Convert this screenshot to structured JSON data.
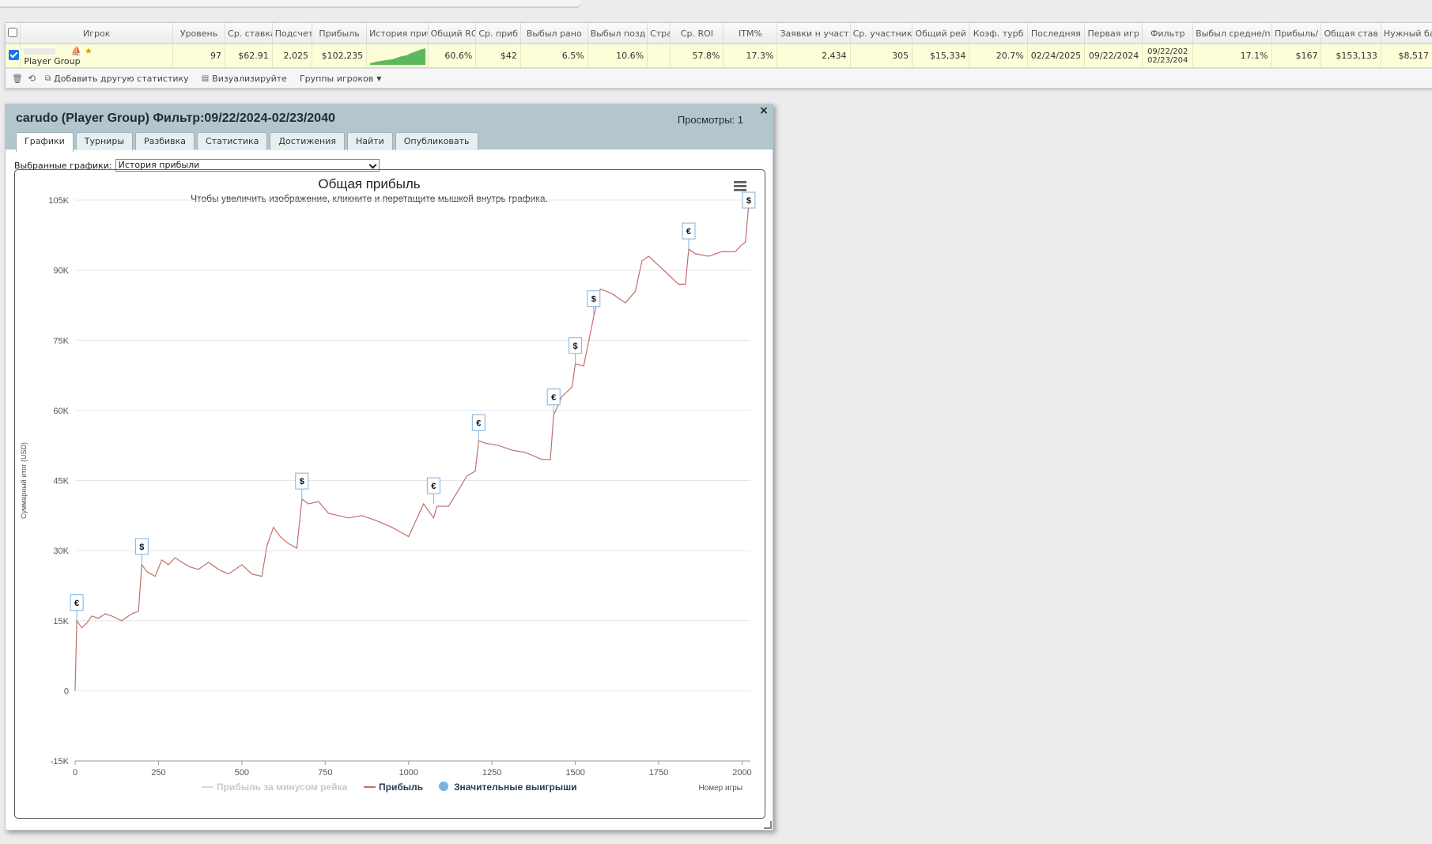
{
  "grid": {
    "columns": [
      "",
      "Игрок",
      "Уровень",
      "Ср. ставка",
      "Подсчет",
      "Прибыль",
      "История прибы",
      "Общий ROI",
      "Ср. приб",
      "Выбыл рано",
      "Выбыл позд",
      "Стра",
      "Ср. ROI",
      "ITM%",
      "Заявки н участ",
      "Ср. участник",
      "Общий рей",
      "Коэф. турб",
      "Последняя",
      "Первая игр",
      "Фильтр",
      "Выбыл средне/п",
      "Прибыль/",
      "Общая став",
      "Нужный ба"
    ],
    "row": {
      "player": "Player Group",
      "level": "97",
      "avg_stake": "$62.91",
      "count": "2,025",
      "profit": "$102,235",
      "total_roi": "60.6%",
      "avg_profit": "$42",
      "early_out": "6.5%",
      "late_out": "10.6%",
      "stra": "",
      "avg_roi": "57.8%",
      "itm": "17.3%",
      "entries": "2,434",
      "avg_field": "305",
      "total_rake": "$15,334",
      "turbo": "20.7%",
      "last": "02/24/2025",
      "first": "09/22/2024",
      "filter_line1": "09/22/202",
      "filter_line2": "02/23/204",
      "mid_out": "17.1%",
      "profit_per": "$167",
      "total_stake": "$153,133",
      "needed_bank": "$8,517"
    }
  },
  "toolbar": {
    "add_stat": "Добавить другую статистику",
    "visualize": "Визуализируйте",
    "groups": "Группы игроков"
  },
  "dialog": {
    "title": "carudo (Player Group) Фильтр:09/22/2024-02/23/2040",
    "views": "Просмотры: 1",
    "close": "×",
    "tabs": [
      "Графики",
      "Турниры",
      "Разбивка",
      "Статистика",
      "Достижения",
      "Найти",
      "Опубликовать"
    ],
    "select_label": "Выбранные графики:",
    "select_value": "История прибыли"
  },
  "chart_data": {
    "type": "line",
    "title": "Общая прибыль",
    "subtitle": "Чтобы увеличить изображение, кликните и перетащите мышкой внутрь графика.",
    "xlabel": "Номер игры",
    "ylabel": "Суммарный итог (USD)",
    "xlim": [
      0,
      2025
    ],
    "ylim": [
      -15000,
      105000
    ],
    "xticks": [
      0,
      250,
      500,
      750,
      1000,
      1250,
      1500,
      1750,
      2000
    ],
    "xtick_labels": [
      "0",
      "250",
      "500",
      "750",
      "1000",
      "1250",
      "1500",
      "1750",
      "2000"
    ],
    "yticks": [
      -15000,
      0,
      15000,
      30000,
      45000,
      60000,
      75000,
      90000,
      105000
    ],
    "ytick_labels": [
      "-15K",
      "0",
      "15K",
      "30K",
      "45K",
      "60K",
      "75K",
      "90K",
      "105K"
    ],
    "grid": true,
    "legend_position": "bottom",
    "legend": [
      "Прибыль за минусом рейка",
      "Прибыль",
      "Значительные выигрыши"
    ],
    "series": [
      {
        "name": "Прибыль",
        "color": "#c0706d",
        "x": [
          0,
          5,
          20,
          35,
          50,
          70,
          90,
          110,
          140,
          170,
          190,
          200,
          215,
          240,
          260,
          280,
          300,
          320,
          345,
          370,
          400,
          430,
          460,
          500,
          530,
          560,
          575,
          595,
          615,
          640,
          665,
          680,
          700,
          730,
          760,
          790,
          820,
          860,
          900,
          950,
          1000,
          1045,
          1075,
          1085,
          1120,
          1150,
          1175,
          1200,
          1210,
          1230,
          1270,
          1310,
          1350,
          1400,
          1425,
          1435,
          1460,
          1490,
          1500,
          1525,
          1555,
          1575,
          1610,
          1650,
          1680,
          1700,
          1720,
          1750,
          1780,
          1810,
          1830,
          1840,
          1860,
          1900,
          1940,
          1980,
          2000,
          2010,
          2020
        ],
        "y": [
          0,
          15000,
          13500,
          14500,
          16000,
          15500,
          16500,
          16000,
          15000,
          16500,
          17000,
          27000,
          25500,
          24500,
          28000,
          27000,
          28500,
          27500,
          26500,
          26000,
          27500,
          26000,
          25000,
          27000,
          25000,
          24500,
          31000,
          35000,
          33000,
          31500,
          30500,
          41000,
          40000,
          40500,
          38000,
          37500,
          37000,
          37500,
          36500,
          35000,
          33000,
          40000,
          37000,
          39500,
          39500,
          43000,
          46000,
          47000,
          53500,
          53000,
          52500,
          51500,
          51000,
          49500,
          49500,
          59000,
          63000,
          65000,
          70000,
          69500,
          80000,
          86000,
          85000,
          83000,
          85500,
          92000,
          93000,
          91000,
          89000,
          87000,
          87000,
          94500,
          93500,
          93000,
          94000,
          94000,
          95500,
          96000,
          104000
        ]
      }
    ],
    "markers": [
      {
        "x": 5,
        "y": 15000,
        "label": "€"
      },
      {
        "x": 200,
        "y": 27000,
        "label": "$"
      },
      {
        "x": 680,
        "y": 41000,
        "label": "$"
      },
      {
        "x": 1075,
        "y": 40000,
        "label": "€"
      },
      {
        "x": 1210,
        "y": 53500,
        "label": "€"
      },
      {
        "x": 1435,
        "y": 59000,
        "label": "€"
      },
      {
        "x": 1500,
        "y": 70000,
        "label": "$"
      },
      {
        "x": 1555,
        "y": 80000,
        "label": "$"
      },
      {
        "x": 1840,
        "y": 94500,
        "label": "€"
      },
      {
        "x": 2020,
        "y": 104000,
        "label": "$"
      }
    ]
  }
}
